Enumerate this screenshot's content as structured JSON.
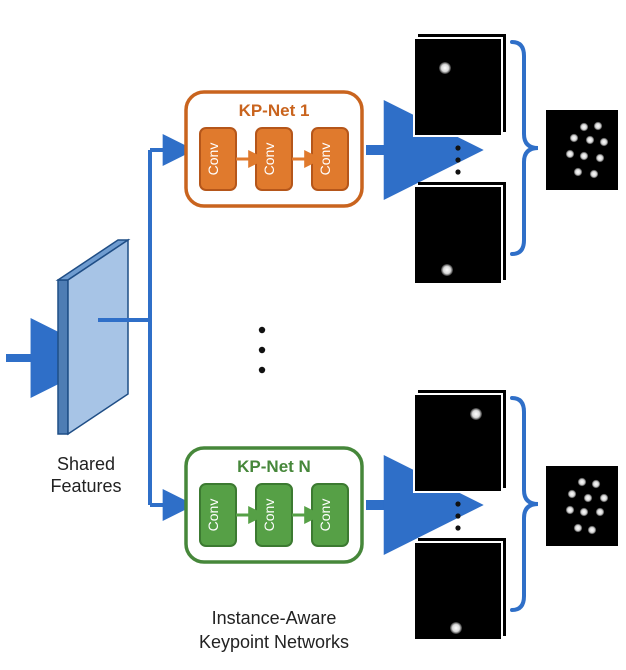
{
  "labels": {
    "shared_features_line1": "Shared",
    "shared_features_line2": "Features",
    "kp_net_1_title": "KP-Net 1",
    "kp_net_n_title": "KP-Net N",
    "conv": "Conv",
    "caption_line1": "Instance-Aware",
    "caption_line2": "Keypoint Networks"
  },
  "colors": {
    "blue_arrow": "#2F6FC8",
    "blue_arrow_dark": "#1F5AB0",
    "feature_face": "#A7C4E6",
    "feature_top": "#6F9CD0",
    "feature_side": "#4E7DB4",
    "net1_border": "#C9641E",
    "net1_fill": "#E07A2D",
    "netN_border": "#46873A",
    "netN_fill": "#56A046",
    "image_bg": "#000000",
    "keypoint_fill": "#E8E8E8",
    "brace": "#2F6FC8"
  },
  "chart_data": {
    "type": "diagram",
    "description": "Neural network architecture: shared feature volume feeds N parallel instance-aware keypoint networks (KP-Net 1 ... KP-Net N), each a stack of Conv layers, each producing per-keypoint heatmaps that are combined to a final keypoint image per branch.",
    "shared_feature_shape": "3D tensor (feature map volume)",
    "branches": [
      "KP-Net 1",
      "...",
      "KP-Net N"
    ],
    "branch_ops": [
      "Conv",
      "Conv",
      "Conv"
    ],
    "branch_outputs_per_net": "multiple single-keypoint heatmaps",
    "branch_final_output": "combined multi-keypoint heatmap",
    "example_keypoints_top_branch_combined": [
      [
        0.55,
        0.24
      ],
      [
        0.7,
        0.22
      ],
      [
        0.45,
        0.36
      ],
      [
        0.62,
        0.38
      ],
      [
        0.78,
        0.42
      ],
      [
        0.4,
        0.55
      ],
      [
        0.55,
        0.58
      ],
      [
        0.72,
        0.6
      ],
      [
        0.48,
        0.74
      ],
      [
        0.65,
        0.78
      ]
    ],
    "example_keypoints_bottom_branch_combined": [
      [
        0.52,
        0.22
      ],
      [
        0.68,
        0.24
      ],
      [
        0.44,
        0.36
      ],
      [
        0.6,
        0.4
      ],
      [
        0.76,
        0.4
      ],
      [
        0.42,
        0.54
      ],
      [
        0.56,
        0.56
      ],
      [
        0.72,
        0.58
      ],
      [
        0.48,
        0.74
      ],
      [
        0.64,
        0.76
      ]
    ]
  }
}
